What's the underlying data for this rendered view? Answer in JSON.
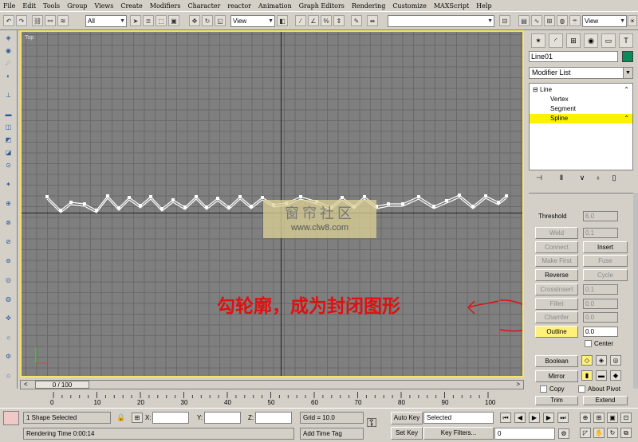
{
  "menu": [
    "File",
    "Edit",
    "Tools",
    "Group",
    "Views",
    "Create",
    "Modifiers",
    "Character",
    "reactor",
    "Animation",
    "Graph Editors",
    "Rendering",
    "Customize",
    "MAXScript",
    "Help"
  ],
  "toolbar": {
    "selection_filter": "All",
    "ref_coord": "View",
    "named_sel": "",
    "render_view": "View"
  },
  "viewport": {
    "label": "Top",
    "watermark_line1": "窗帘社区",
    "watermark_line2": "www.clw8.com",
    "annotation": "勾轮廓，成为封闭图形"
  },
  "spline_points": [
    [
      32,
      207
    ],
    [
      49,
      224
    ],
    [
      62,
      214
    ],
    [
      79,
      216
    ],
    [
      94,
      224
    ],
    [
      108,
      206
    ],
    [
      122,
      221
    ],
    [
      135,
      208
    ],
    [
      149,
      218
    ],
    [
      162,
      207
    ],
    [
      176,
      222
    ],
    [
      190,
      211
    ],
    [
      205,
      220
    ],
    [
      219,
      207
    ],
    [
      232,
      220
    ],
    [
      246,
      209
    ],
    [
      260,
      220
    ],
    [
      274,
      207
    ],
    [
      288,
      219
    ],
    [
      302,
      208
    ],
    [
      316,
      217
    ],
    [
      332,
      215
    ],
    [
      350,
      207
    ],
    [
      370,
      213
    ],
    [
      388,
      220
    ],
    [
      402,
      208
    ],
    [
      417,
      219
    ],
    [
      430,
      207
    ],
    [
      445,
      219
    ],
    [
      460,
      216
    ],
    [
      478,
      216
    ],
    [
      498,
      207
    ],
    [
      517,
      219
    ],
    [
      533,
      212
    ],
    [
      549,
      205
    ],
    [
      566,
      219
    ],
    [
      582,
      206
    ],
    [
      598,
      214
    ],
    [
      608,
      206
    ]
  ],
  "command_panel": {
    "object_name": "Line01",
    "object_color": "#0a8a5a",
    "modifier_list": "Modifier List",
    "stack": [
      "Line",
      "Vertex",
      "Segment",
      "Spline"
    ],
    "threshold_label": "Threshold",
    "threshold_value": "6.0",
    "weld_label": "Weld",
    "weld_value": "0.1",
    "connect_label": "Connect",
    "insert_label": "Insert",
    "make_first_label": "Make First",
    "fuse_label": "Fuse",
    "reverse_label": "Reverse",
    "cycle_label": "Cycle",
    "crossinsert_label": "CrossInsert",
    "crossinsert_value": "0.1",
    "fillet_label": "Fillet",
    "fillet_value": "0.0",
    "chamfer_label": "Chamfer",
    "chamfer_value": "0.0",
    "outline_label": "Outline",
    "outline_value": "0.0",
    "center_label": "Center",
    "boolean_label": "Boolean",
    "mirror_label": "Mirror",
    "copy_label": "Copy",
    "about_pivot_label": "About Pivot",
    "trim_label": "Trim",
    "extend_label": "Extend"
  },
  "timeline": {
    "slider_label": "0 / 100",
    "ticks": [
      "0",
      "10",
      "20",
      "30",
      "40",
      "50",
      "60",
      "70",
      "80",
      "90",
      "100"
    ]
  },
  "status": {
    "selection": "1 Shape Selected",
    "x_label": "X:",
    "y_label": "Y:",
    "z_label": "Z:",
    "grid": "Grid = 10.0",
    "render_time": "Rendering Time  0:00:14",
    "add_time_tag": "Add Time Tag",
    "auto_key": "Auto Key",
    "set_key": "Set Key",
    "selected": "Selected",
    "key_filters": "Key Filters...",
    "frame": "0"
  }
}
